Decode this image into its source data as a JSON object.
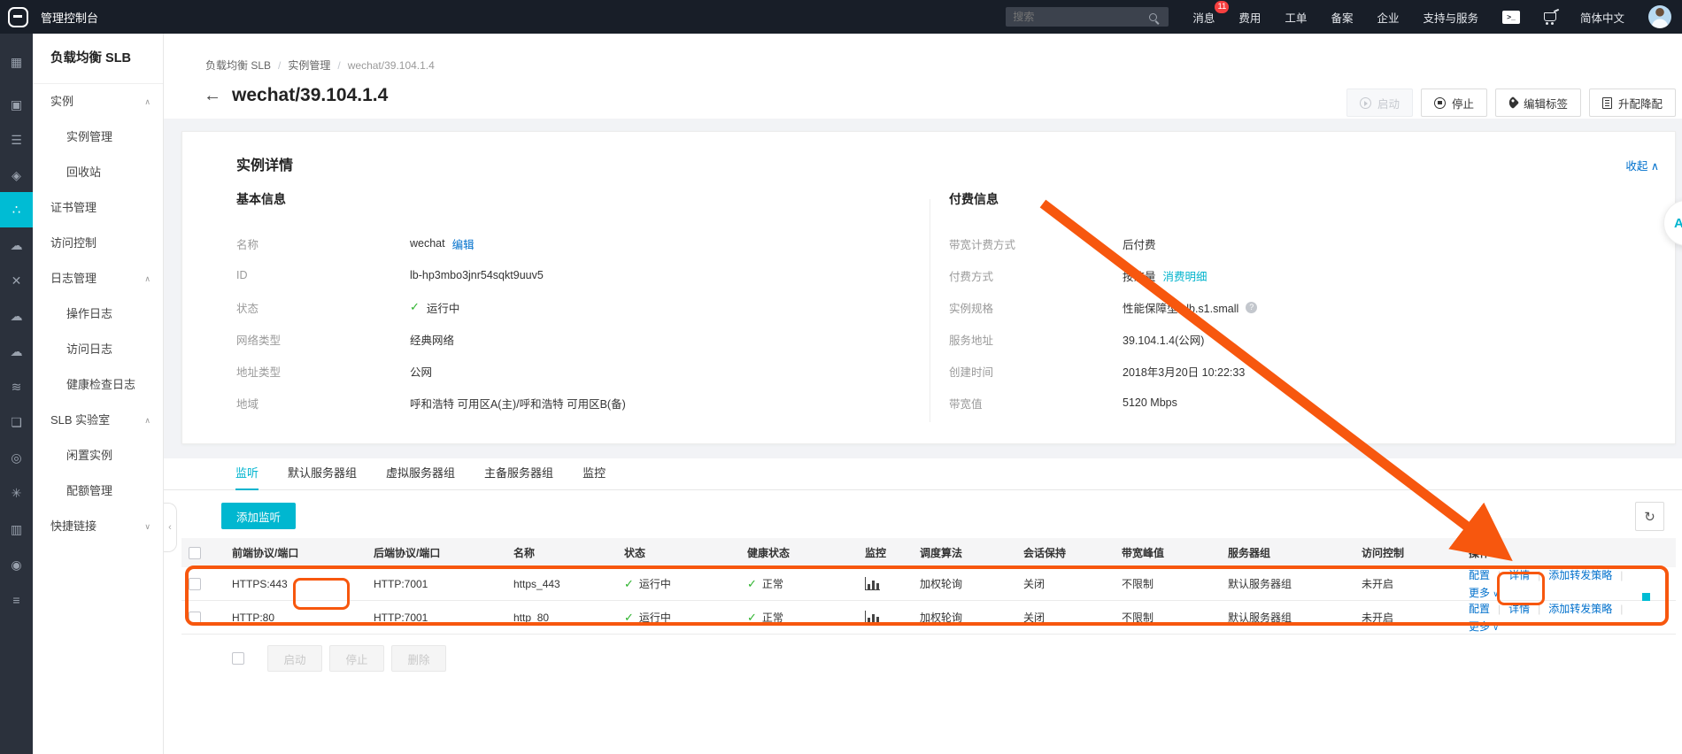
{
  "theme": {
    "accent_teal": "#00bcd4",
    "link_blue": "#0070cc",
    "success_green": "#2db32d",
    "annotation_orange": "#f7570e",
    "topbar_bg": "#181e28",
    "badge_red": "#f53f3f"
  },
  "topbar": {
    "console_title": "管理控制台",
    "search_placeholder": "搜索",
    "items": [
      {
        "label": "消息",
        "badge": "11"
      },
      {
        "label": "费用"
      },
      {
        "label": "工单"
      },
      {
        "label": "备案"
      },
      {
        "label": "企业"
      },
      {
        "label": "支持与服务"
      }
    ],
    "lang": "简体中文"
  },
  "rail": {
    "icons": [
      {
        "glyph": "▦",
        "name": "apps-grid-icon"
      },
      {
        "glyph": "▣",
        "name": "server-group-icon"
      },
      {
        "glyph": "☰",
        "name": "instance-list-icon"
      },
      {
        "glyph": "◈",
        "name": "security-shield-icon"
      },
      {
        "glyph": "∴",
        "name": "slb-icon",
        "active": true
      },
      {
        "glyph": "☁",
        "name": "cdn-cloud-icon"
      },
      {
        "glyph": "✕",
        "name": "cross-network-icon"
      },
      {
        "glyph": "☁",
        "name": "multi-cloud-icon"
      },
      {
        "glyph": "☁",
        "name": "cloud-icon"
      },
      {
        "glyph": "≋",
        "name": "stack-layers-icon"
      },
      {
        "glyph": "❏",
        "name": "frame-icon"
      },
      {
        "glyph": "◎",
        "name": "monitor-target-icon"
      },
      {
        "glyph": "✳",
        "name": "star-network-icon"
      },
      {
        "glyph": "▥",
        "name": "bar-chart-icon"
      },
      {
        "glyph": "◉",
        "name": "eye-icon"
      },
      {
        "glyph": "≡",
        "name": "layers-icon"
      }
    ]
  },
  "sidebar": {
    "title": "负载均衡 SLB",
    "collapse_chevron": "‹",
    "items": [
      {
        "label": "实例",
        "chevron": "∧"
      },
      {
        "label": "实例管理",
        "sub": true,
        "active": true
      },
      {
        "label": "回收站",
        "sub": true
      },
      {
        "label": "证书管理"
      },
      {
        "label": "访问控制"
      },
      {
        "label": "日志管理",
        "chevron": "∧"
      },
      {
        "label": "操作日志",
        "sub": true
      },
      {
        "label": "访问日志",
        "sub": true
      },
      {
        "label": "健康检查日志",
        "sub": true
      },
      {
        "label": "SLB 实验室",
        "chevron": "∧"
      },
      {
        "label": "闲置实例",
        "sub": true
      },
      {
        "label": "配额管理",
        "sub": true
      },
      {
        "label": "快捷链接",
        "chevron": "∨"
      }
    ]
  },
  "breadcrumb": {
    "item1": "负载均衡 SLB",
    "item2": "实例管理",
    "item3": "wechat/39.104.1.4"
  },
  "page": {
    "back_arrow": "←",
    "title": "wechat/39.104.1.4",
    "actions": [
      {
        "label": "启动",
        "icon": "play",
        "disabled": true
      },
      {
        "label": "停止",
        "icon": "stop"
      },
      {
        "label": "编辑标签",
        "icon": "tag"
      },
      {
        "label": "升配降配",
        "icon": "doc"
      }
    ]
  },
  "details": {
    "title": "实例详情",
    "collapse_label": "收起",
    "collapse_chevron": "∧",
    "basic_heading": "基本信息",
    "billing_heading": "付费信息",
    "basic_rows": [
      {
        "label": "名称",
        "value": "wechat",
        "link": "编辑"
      },
      {
        "label": "ID",
        "value": "lb-hp3mbo3jnr54sqkt9uuv5"
      },
      {
        "label": "状态",
        "value": "运行中",
        "check": true
      },
      {
        "label": "网络类型",
        "value": "经典网络"
      },
      {
        "label": "地址类型",
        "value": "公网"
      },
      {
        "label": "地域",
        "value": "呼和浩特 可用区A(主)/呼和浩特 可用区B(备)"
      }
    ],
    "billing_rows": [
      {
        "label": "带宽计费方式",
        "value": "后付费"
      },
      {
        "label": "付费方式",
        "value": "按流量",
        "link": "消费明细",
        "teal": true
      },
      {
        "label": "实例规格",
        "value": "性能保障型 slb.s1.small",
        "help": true
      },
      {
        "label": "服务地址",
        "value": "39.104.1.4(公网)"
      },
      {
        "label": "创建时间",
        "value": "2018年3月20日 10:22:33"
      },
      {
        "label": "带宽值",
        "value": "5120 Mbps"
      }
    ]
  },
  "tabs": [
    {
      "label": "监听",
      "active": true
    },
    {
      "label": "默认服务器组"
    },
    {
      "label": "虚拟服务器组"
    },
    {
      "label": "主备服务器组"
    },
    {
      "label": "监控"
    }
  ],
  "table": {
    "add_button": "添加监听",
    "refresh_icon": "↻",
    "columns": [
      "前端协议/端口",
      "后端协议/端口",
      "名称",
      "状态",
      "健康状态",
      "监控",
      "调度算法",
      "会话保持",
      "带宽峰值",
      "服务器组",
      "访问控制",
      "操作"
    ],
    "rows": [
      {
        "front": "HTTPS:443",
        "back": "HTTP:7001",
        "name": "https_443",
        "status": "运行中",
        "health": "正常",
        "algo": "加权轮询",
        "session": "关闭",
        "bandwidth": "不限制",
        "group": "默认服务器组",
        "acl": "未开启"
      },
      {
        "front": "HTTP:80",
        "back": "HTTP:7001",
        "name": "http_80",
        "status": "运行中",
        "health": "正常",
        "algo": "加权轮询",
        "session": "关闭",
        "bandwidth": "不限制",
        "group": "默认服务器组",
        "acl": "未开启"
      }
    ],
    "action_labels": {
      "config": "配置",
      "detail": "详情",
      "add_rule": "添加转发策略"
    },
    "more_label": "更多",
    "more_chevron": "∨",
    "footer_buttons": [
      "启动",
      "停止",
      "删除"
    ]
  },
  "floating": {
    "a_button": "A"
  }
}
